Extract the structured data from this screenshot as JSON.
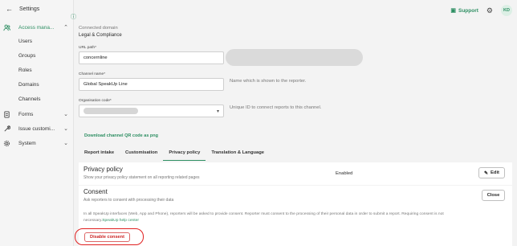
{
  "sidebar": {
    "back_label": "Settings",
    "items": [
      {
        "label": "Access mana...",
        "icon": "users-icon",
        "chevron": "up"
      },
      {
        "label": "Users"
      },
      {
        "label": "Groups"
      },
      {
        "label": "Roles"
      },
      {
        "label": "Domains"
      },
      {
        "label": "Channels"
      },
      {
        "label": "Forms",
        "icon": "document-icon",
        "chevron": "down"
      },
      {
        "label": "Issue customi...",
        "icon": "wrench-icon",
        "chevron": "down"
      },
      {
        "label": "System",
        "icon": "gear-icon",
        "chevron": "down"
      }
    ]
  },
  "header": {
    "support_label": "Support",
    "avatar_initials": "KD"
  },
  "main": {
    "connected_domain_label": "Connected domain",
    "connected_domain_value": "Legal & Compliance",
    "url_path_label": "URL path*",
    "url_path_value": "concernline",
    "channel_name_label": "Channel name*",
    "channel_name_value": "Global SpeakUp Line",
    "channel_name_help": "Name which is shown to the reporter.",
    "org_code_label": "Organisation code*",
    "org_code_help": "Unique ID to connect reports to this channel.",
    "download_qr_label": "Download channel QR code as png",
    "tabs": [
      "Report intake",
      "Customisation",
      "Privacy policy",
      "Translation & Language"
    ],
    "privacy": {
      "title": "Privacy policy",
      "description": "Show your privacy policy statement on all reporting related pages",
      "status": "Enabled",
      "edit_label": "Edit"
    },
    "consent": {
      "title": "Consent",
      "description": "Ask reporters to consent with processing their data",
      "close_label": "Close",
      "body_line1": "In all SpeakUp interfaces (Web, App and Phone), reporters will be asked to provide consent. Reporter must consent to the processing of their personal data in order to submit a report. Requiring consent is not",
      "body_line2_prefix": "necessary.",
      "help_link": "SpeakUp help center",
      "disable_label": "Disable consent"
    }
  },
  "colors": {
    "accent": "#2e8f63",
    "danger": "#e02020"
  }
}
